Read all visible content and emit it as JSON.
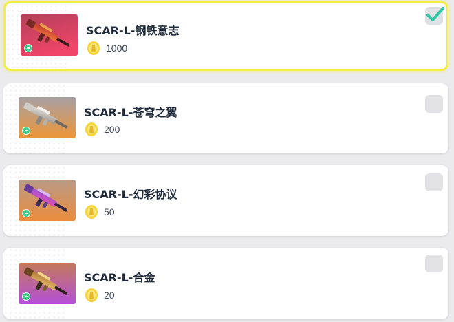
{
  "items": [
    {
      "name": "SCAR-L-钢铁意志",
      "price": "1000",
      "selected": true,
      "thumb_gradient": [
        "#b2415a",
        "#ef4468"
      ],
      "gun_colors": [
        "#c2382f",
        "#f07a3a"
      ]
    },
    {
      "name": "SCAR-L-苍穹之翼",
      "price": "200",
      "selected": false,
      "thumb_gradient": [
        "#a7a0a4",
        "#ee9637"
      ],
      "gun_colors": [
        "#e6e2dc",
        "#9a958e"
      ]
    },
    {
      "name": "SCAR-L-幻彩协议",
      "price": "50",
      "selected": false,
      "thumb_gradient": [
        "#b99a86",
        "#ea8d3d"
      ],
      "gun_colors": [
        "#9a52d8",
        "#e34fb0"
      ]
    },
    {
      "name": "SCAR-L-合金",
      "price": "20",
      "selected": false,
      "thumb_gradient": [
        "#c27a5a",
        "#b44fd9"
      ],
      "gun_colors": [
        "#b47a3a",
        "#e6c06a"
      ]
    }
  ],
  "icons": {
    "currency": "gold-coin-icon",
    "selected_mark": "check-icon",
    "rarity": "rarity-badge-icon",
    "weapon": "rifle-icon"
  },
  "colors": {
    "selected_border": "#f4ef3f",
    "check": "#2fc8a4",
    "coin": "#f5d43a"
  }
}
